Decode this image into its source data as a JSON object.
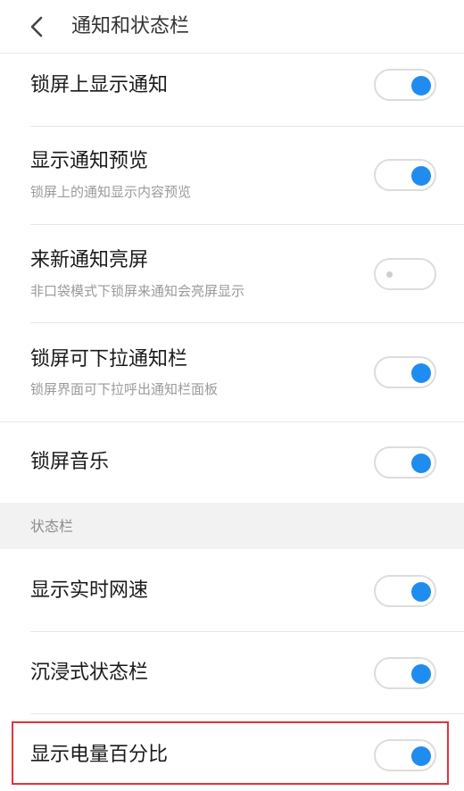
{
  "header": {
    "title": "通知和状态栏"
  },
  "rows": [
    {
      "title": "锁屏上显示通知",
      "subtitle": "",
      "enabled": true
    },
    {
      "title": "显示通知预览",
      "subtitle": "锁屏上的通知显示内容预览",
      "enabled": true
    },
    {
      "title": "来新通知亮屏",
      "subtitle": "非口袋模式下锁屏来通知会亮屏显示",
      "enabled": false
    },
    {
      "title": "锁屏可下拉通知栏",
      "subtitle": "锁屏界面可下拉呼出通知栏面板",
      "enabled": true
    },
    {
      "title": "锁屏音乐",
      "subtitle": "",
      "enabled": true
    }
  ],
  "section": {
    "label": "状态栏"
  },
  "status_rows": [
    {
      "title": "显示实时网速",
      "enabled": true
    },
    {
      "title": "沉浸式状态栏",
      "enabled": true
    },
    {
      "title": "显示电量百分比",
      "enabled": true
    }
  ],
  "colors": {
    "accent": "#1f8cf0",
    "highlight": "#e0353b",
    "section_bg": "#f2f2f2"
  }
}
